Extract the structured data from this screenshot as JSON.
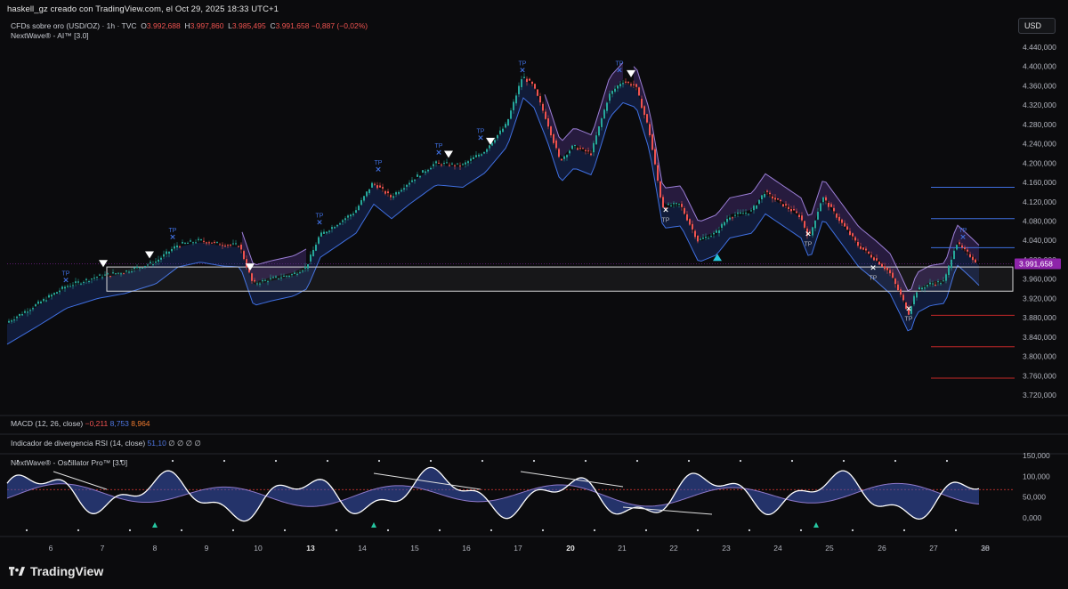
{
  "header": {
    "title_line": "haskell_gz creado con TradingView.com, el Oct 29, 2025 18:33 UTC+1",
    "symbol": "CFDs sobre oro (USD/OZ) · 1h · TVC",
    "ohlc": {
      "o": "3.992,688",
      "h": "3.997,860",
      "l": "3.985,495",
      "c": "3.991,658",
      "change": "−0,887 (−0,02%)"
    },
    "indicator": "NextWave® - AI™ [3.0]"
  },
  "currency_button": "USD",
  "price_axis": {
    "ticks": [
      "4.440,000",
      "4.400,000",
      "4.360,000",
      "4.320,000",
      "4.280,000",
      "4.240,000",
      "4.200,000",
      "4.160,000",
      "4.120,000",
      "4.080,000",
      "4.040,000",
      "4.000,000",
      "3.960,000",
      "3.920,000",
      "3.880,000",
      "3.840,000",
      "3.800,000",
      "3.760,000",
      "3.720,000"
    ],
    "last_price": "3.991,658",
    "last_price_color": "#8e24aa"
  },
  "panes": {
    "macd": {
      "name": "MACD (12, 26, close)",
      "v1": "−0,211",
      "v2": "8,753",
      "v3": "8,964"
    },
    "rsi_div": {
      "name": "Indicador de divergencia RSI (14, close)",
      "v1": "51,10",
      "rest": "∅ ∅ ∅ ∅"
    },
    "oscillator": {
      "name": "NextWave® - Oscillator Pro™ [3.0]",
      "ticks": [
        "150,000",
        "100,000",
        "50,000",
        "0,000"
      ]
    }
  },
  "time_axis": [
    "6",
    "7",
    "8",
    "9",
    "10",
    "13",
    "14",
    "15",
    "16",
    "17",
    "20",
    "21",
    "22",
    "23",
    "24",
    "25",
    "26",
    "27",
    "28",
    "29",
    "30"
  ],
  "signal_labels": {
    "tp": "TP"
  },
  "colors": {
    "bull": "#26a69a",
    "bear": "#ef5350",
    "band": "#3f6fe0",
    "cloud": "#7e57c2",
    "bg": "#0b0b0d"
  },
  "brand": "TradingView"
}
